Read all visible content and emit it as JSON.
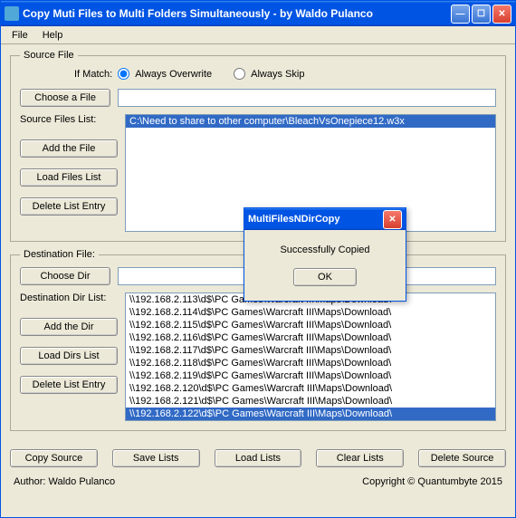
{
  "window": {
    "title": "Copy Muti Files to Multi Folders Simultaneously - by Waldo Pulanco"
  },
  "menu": {
    "file": "File",
    "help": "Help"
  },
  "source": {
    "legend": "Source File",
    "ifMatch": "If Match:",
    "overwrite": "Always Overwrite",
    "skip": "Always Skip",
    "chooseFile": "Choose a File",
    "filesListLabel": "Source Files List:",
    "addFile": "Add the File",
    "loadList": "Load Files List",
    "deleteEntry": "Delete List Entry",
    "fileValue": "",
    "items": [
      "C:\\Need to share to other computer\\BleachVsOnepiece12.w3x"
    ]
  },
  "dest": {
    "legend": "Destination File:",
    "chooseDir": "Choose Dir",
    "dirListLabel": "Destination Dir List:",
    "addDir": "Add the Dir",
    "loadList": "Load Dirs List",
    "deleteEntry": "Delete List Entry",
    "dirValue": "",
    "items": [
      "\\\\192.168.2.113\\d$\\PC Games\\Warcraft III\\Maps\\Download\\",
      "\\\\192.168.2.114\\d$\\PC Games\\Warcraft III\\Maps\\Download\\",
      "\\\\192.168.2.115\\d$\\PC Games\\Warcraft III\\Maps\\Download\\",
      "\\\\192.168.2.116\\d$\\PC Games\\Warcraft III\\Maps\\Download\\",
      "\\\\192.168.2.117\\d$\\PC Games\\Warcraft III\\Maps\\Download\\",
      "\\\\192.168.2.118\\d$\\PC Games\\Warcraft III\\Maps\\Download\\",
      "\\\\192.168.2.119\\d$\\PC Games\\Warcraft III\\Maps\\Download\\",
      "\\\\192.168.2.120\\d$\\PC Games\\Warcraft III\\Maps\\Download\\",
      "\\\\192.168.2.121\\d$\\PC Games\\Warcraft III\\Maps\\Download\\",
      "\\\\192.168.2.122\\d$\\PC Games\\Warcraft III\\Maps\\Download\\"
    ],
    "selectedIndex": 9
  },
  "footer": {
    "copy": "Copy Source",
    "save": "Save Lists",
    "load": "Load Lists",
    "clear": "Clear Lists",
    "delete": "Delete Source"
  },
  "author": {
    "by": "Author: Waldo Pulanco",
    "copyright": "Copyright © Quantumbyte 2015"
  },
  "dialog": {
    "title": "MultiFilesNDirCopy",
    "message": "Successfully Copied",
    "ok": "OK"
  }
}
